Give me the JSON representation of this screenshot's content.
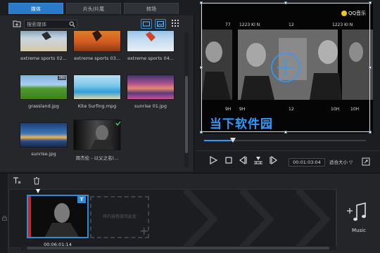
{
  "tabs": [
    {
      "label": "媒体",
      "active": true
    },
    {
      "label": "片头/片尾",
      "active": false
    },
    {
      "label": "转场",
      "active": false
    }
  ],
  "search": {
    "placeholder": "搜索媒体"
  },
  "media": [
    {
      "label": "extreme sports 02...",
      "badge": ""
    },
    {
      "label": "extreme sports 03...",
      "badge": ""
    },
    {
      "label": "extreme sports 04...",
      "badge": ""
    },
    {
      "label": "grassland.jpg",
      "badge": "360"
    },
    {
      "label": "Kite Surfing.mpg",
      "badge": ""
    },
    {
      "label": "sunrise 01.jpg",
      "badge": ""
    },
    {
      "label": "sunrise.jpg",
      "badge": ""
    },
    {
      "label": "周杰伦 - 以父之名(...",
      "badge": ""
    }
  ],
  "preview": {
    "logo": "QQ音乐",
    "overlay_title": "当下软件园",
    "film_labels_top": [
      "77",
      "1223 KI N",
      "12",
      "1223 KI N"
    ],
    "film_labels_bottom": [
      "9H",
      "9H",
      "12",
      "10H",
      "10H"
    ],
    "progress_percent": 18,
    "timecode": "00:01:03:04",
    "fit_label": "适合大小",
    "fit_arrow": "▽"
  },
  "timeline": {
    "clip_time": "00:06:01:14",
    "clip_badge": "T",
    "drop_hint": "将内容拖放到此处",
    "music_label": "Music"
  },
  "colors": {
    "accent": "#2f8ad8",
    "title_blue": "#2f9bff",
    "bg": "#1b1d21"
  }
}
